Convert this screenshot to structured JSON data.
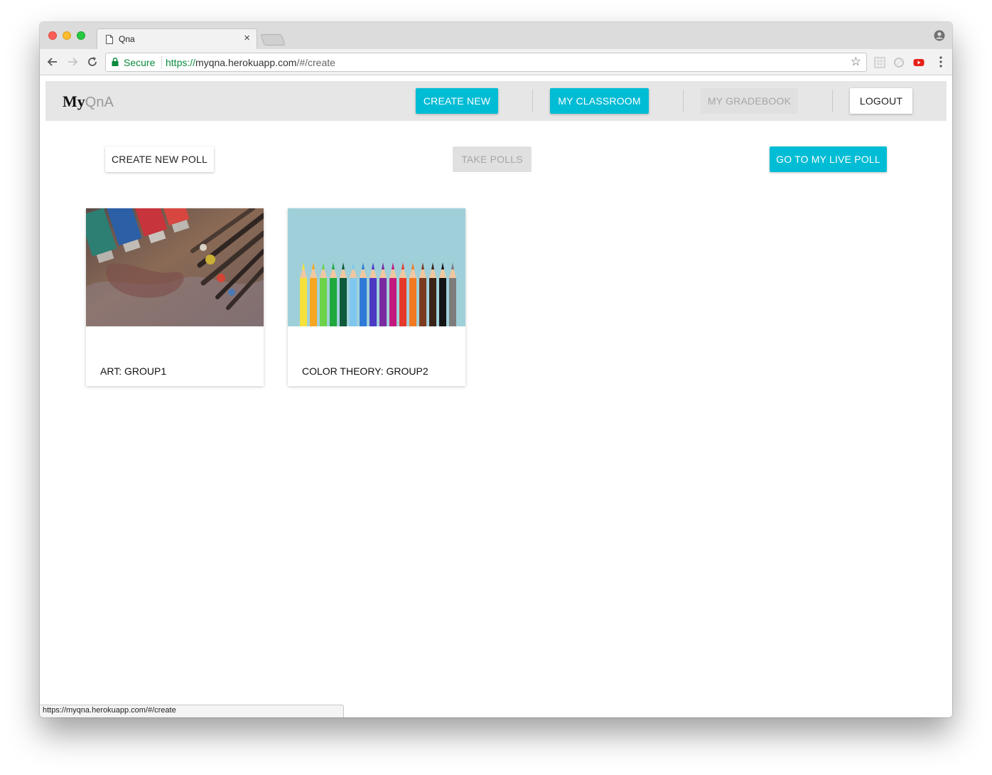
{
  "browser": {
    "tab_title": "Qna",
    "tab_close": "×",
    "secure_label": "Secure",
    "url_scheme": "https://",
    "url_host": "myqna.herokuapp.com",
    "url_path": "/#/create",
    "status_url": "https://myqna.herokuapp.com/#/create"
  },
  "app": {
    "logo_my": "My",
    "logo_qna": "QnA",
    "nav": {
      "create_new": "CREATE NEW",
      "my_classroom": "MY CLASSROOM",
      "my_gradebook": "MY GRADEBOOK",
      "logout": "LOGOUT"
    },
    "actions": {
      "create_new_poll": "CREATE NEW POLL",
      "take_polls": "TAKE POLLS",
      "go_to_live_poll": "GO TO MY LIVE POLL"
    },
    "cards": [
      {
        "title": "ART: GROUP1",
        "image": "paint-tubes-and-brushes"
      },
      {
        "title": "COLOR THEORY: GROUP2",
        "image": "colored-pencils"
      }
    ]
  },
  "colors": {
    "accent": "#00bcd4",
    "appbar_bg": "#e6e6e6",
    "disabled_bg": "#e0e0e0",
    "disabled_text": "#a6a6a6"
  }
}
